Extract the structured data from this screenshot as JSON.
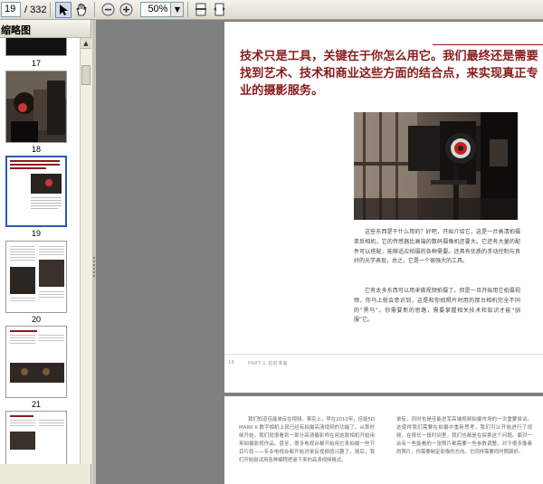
{
  "toolbar": {
    "page_current": "19",
    "page_total": "/ 332",
    "zoom": "50%"
  },
  "panel": {
    "title": "缩略图"
  },
  "thumbnails": {
    "labels": [
      "17",
      "18",
      "19",
      "20",
      "21"
    ]
  },
  "document": {
    "headline": "技术只是工具，关键在于你怎么用它。我们最终还是需要找到艺术、技术和商业这些方面的结合点，来实现真正专业的摄影服务。",
    "para1": "这些东西是干什么用的？好吧，开始介绍它，这是一台高清拍摄单反相机，它的传感器比高端的数码摄像机还要大。它还有大量的配件可以搭配，能够适应拍摄的各种需要。还具有优质的手动控制与良好的光学表现，总之，它是一个很强大的工具。",
    "para2": "它有太多东西可以用来做视频拍摄了。但是一旦开始用它拍摄视频，你马上就会意识到，这是和你拍照片时用的那台相机完全不同的“黑马”。你需要新的思路，需要掌握相关技术和知识才能“驯服”它。",
    "footer": "PART 1  拍前准备",
    "page_number": "16",
    "page2_col1": "我们知道佳能单反在视频。事实上，早在2010年，佳能5D MARK II 数字相机上就已经有拍摄高清视频的功能了。从那时候开始，我们就很看到一部分高清摄影师在用这款相机开始用来拍摄影视作品。甚至，很多电视台都开始用它来拍摄一些节目片段——专业电视台都开始对单反视频感兴趣了。随后，我们开始尝试用各种编程把录下来的高清视频格式。",
    "page2_col2": "单反，同时也是佳能进军高端视频拍摄市场的一次重要尝试。这使得我们需要在拍摄中重新思考。我们可以开始进行了视频，在很长一段时间里，我们也都是在探索这个问题。面对一台有一些能看的一张照片都需要一些参数调整。对于很多像素的照片，你需要制定影像的方向。它同样需要同时照顾好。"
  }
}
